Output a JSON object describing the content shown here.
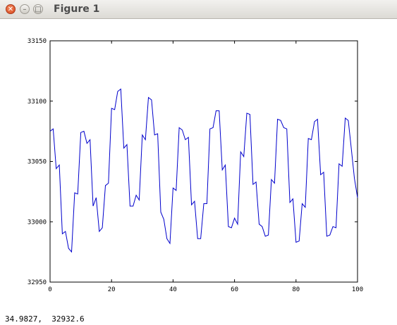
{
  "window": {
    "title": "Figure 1",
    "close_glyph": "✕",
    "minimize_glyph": "–",
    "maximize_glyph": "□"
  },
  "status_bar": {
    "coords": "34.9827,  32932.6"
  },
  "colors": {
    "line": "#0000cc",
    "axes": "#000000",
    "background": "#ffffff"
  },
  "chart_data": {
    "type": "line",
    "title": "",
    "xlabel": "",
    "ylabel": "",
    "xlim": [
      0,
      100
    ],
    "ylim": [
      32950,
      33150
    ],
    "xticks": [
      0,
      20,
      40,
      60,
      80,
      100
    ],
    "yticks": [
      32950,
      33000,
      33050,
      33100,
      33150
    ],
    "grid": false,
    "series": [
      {
        "color": "#0000cc",
        "x": [
          0,
          1,
          2,
          3,
          4,
          5,
          6,
          7,
          8,
          9,
          10,
          11,
          12,
          13,
          14,
          15,
          16,
          17,
          18,
          19,
          20,
          21,
          22,
          23,
          24,
          25,
          26,
          27,
          28,
          29,
          30,
          31,
          32,
          33,
          34,
          35,
          36,
          37,
          38,
          39,
          40,
          41,
          42,
          43,
          44,
          45,
          46,
          47,
          48,
          49,
          50,
          51,
          52,
          53,
          54,
          55,
          56,
          57,
          58,
          59,
          60,
          61,
          62,
          63,
          64,
          65,
          66,
          67,
          68,
          69,
          70,
          71,
          72,
          73,
          74,
          75,
          76,
          77,
          78,
          79,
          80,
          81,
          82,
          83,
          84,
          85,
          86,
          87,
          88,
          89,
          90,
          91,
          92,
          93,
          94,
          95,
          96,
          97,
          98,
          99,
          100
        ],
        "y": [
          33075,
          33077,
          33044,
          33047,
          32990,
          32992,
          32978,
          32975,
          33024,
          33023,
          33074,
          33075,
          33065,
          33068,
          33013,
          33020,
          32992,
          32995,
          33030,
          33032,
          33094,
          33093,
          33108,
          33110,
          33061,
          33064,
          33013,
          33013,
          33022,
          33018,
          33072,
          33068,
          33103,
          33101,
          33072,
          33073,
          33008,
          33002,
          32986,
          32982,
          33028,
          33026,
          33078,
          33076,
          33068,
          33070,
          33014,
          33017,
          32986,
          32986,
          33015,
          33015,
          33077,
          33078,
          33092,
          33092,
          33043,
          33047,
          32996,
          32995,
          33003,
          32998,
          33058,
          33054,
          33090,
          33089,
          33031,
          33033,
          32998,
          32996,
          32988,
          32989,
          33035,
          33032,
          33085,
          33084,
          33078,
          33077,
          33016,
          33019,
          32983,
          32984,
          33015,
          33012,
          33069,
          33068,
          33083,
          33085,
          33039,
          33041,
          32988,
          32989,
          32996,
          32995,
          33048,
          33046,
          33086,
          33084,
          33060,
          33036,
          33020
        ]
      }
    ]
  }
}
